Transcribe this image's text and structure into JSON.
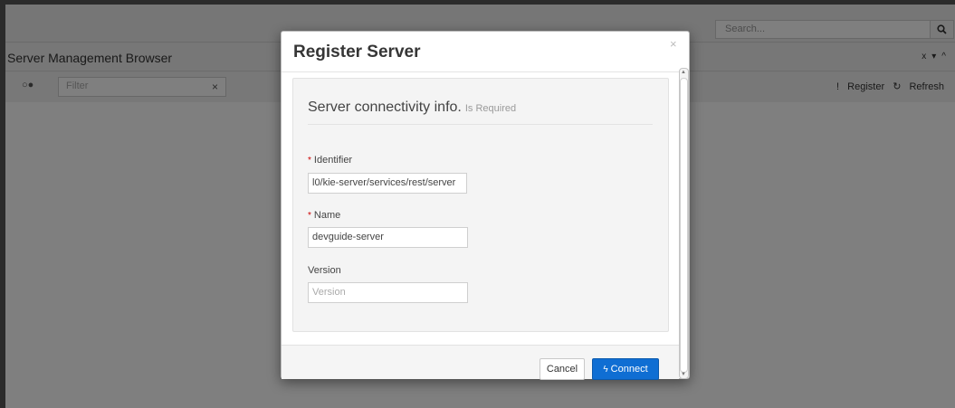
{
  "app": {
    "search_placeholder": "Search...",
    "panel_title": "Server Management Browser",
    "panel_controls": [
      "x",
      "▾",
      "^"
    ],
    "filter_placeholder": "Filter",
    "filter_clear": "×",
    "register_label": "Register",
    "refresh_label": "Refresh"
  },
  "modal": {
    "title": "Register Server",
    "close": "×",
    "section_title": "Server connectivity info.",
    "section_hint": "Is Required",
    "fields": {
      "identifier": {
        "label": "Identifier",
        "required_mark": "*",
        "value": "l0/kie-server/services/rest/server"
      },
      "name": {
        "label": "Name",
        "required_mark": "*",
        "value": "devguide-server"
      },
      "version": {
        "label": "Version",
        "placeholder": "Version",
        "value": ""
      }
    },
    "cancel_label": "Cancel",
    "connect_label": "Connect"
  },
  "colors": {
    "primary": "#0f6ed3",
    "required": "#cc0000",
    "backdrop": "rgba(0,0,0,0.5)"
  }
}
